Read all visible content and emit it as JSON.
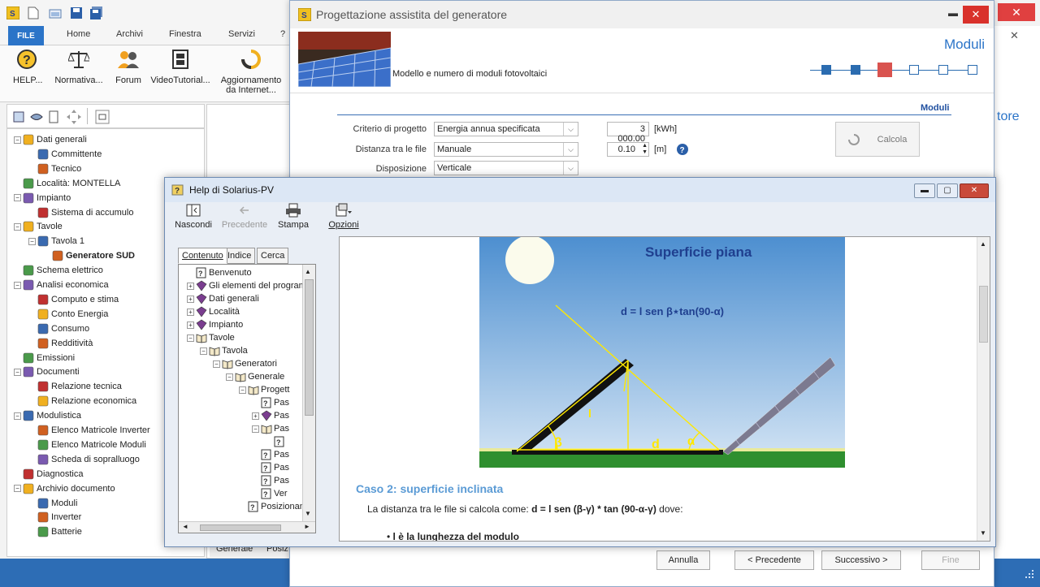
{
  "app": {
    "ribbon_tabs": [
      "FILE",
      "Home",
      "Archivi",
      "Finestra",
      "Servizi",
      "?"
    ],
    "ribbon_buttons": [
      {
        "label": "HELP...",
        "icon": "help-icon"
      },
      {
        "label": "Normativa...",
        "icon": "scales-icon"
      },
      {
        "label": "Forum",
        "icon": "users-icon"
      },
      {
        "label": "VideoTutorial...",
        "icon": "film-icon"
      },
      {
        "label": "Aggiornamento\nda Internet...",
        "icon": "refresh-icon"
      }
    ],
    "right_label": "tore",
    "close_x": "✕",
    "tree": [
      {
        "label": "Dati generali",
        "level": 0,
        "bold": false
      },
      {
        "label": "Committente",
        "level": 1
      },
      {
        "label": "Tecnico",
        "level": 1
      },
      {
        "label": "Località: MONTELLA",
        "level": 0
      },
      {
        "label": "Impianto",
        "level": 0
      },
      {
        "label": "Sistema di accumulo",
        "level": 1
      },
      {
        "label": "Tavole",
        "level": 0
      },
      {
        "label": "Tavola 1",
        "level": 1
      },
      {
        "label": "Generatore SUD",
        "level": 2,
        "bold": true
      },
      {
        "label": "Schema elettrico",
        "level": 0
      },
      {
        "label": "Analisi economica",
        "level": 0
      },
      {
        "label": "Computo e stima",
        "level": 1
      },
      {
        "label": "Conto Energia",
        "level": 1
      },
      {
        "label": "Consumo",
        "level": 1
      },
      {
        "label": "Redditività",
        "level": 1
      },
      {
        "label": "Emissioni",
        "level": 0
      },
      {
        "label": "Documenti",
        "level": 0
      },
      {
        "label": "Relazione tecnica",
        "level": 1
      },
      {
        "label": "Relazione economica",
        "level": 1
      },
      {
        "label": "Modulistica",
        "level": 0
      },
      {
        "label": "Elenco Matricole Inverter",
        "level": 1
      },
      {
        "label": "Elenco Matricole Moduli",
        "level": 1
      },
      {
        "label": "Scheda di sopralluogo",
        "level": 1
      },
      {
        "label": "Diagnostica",
        "level": 0
      },
      {
        "label": "Archivio documento",
        "level": 0
      },
      {
        "label": "Moduli",
        "level": 1
      },
      {
        "label": "Inverter",
        "level": 1
      },
      {
        "label": "Batterie",
        "level": 1
      }
    ],
    "bottom_tabs": [
      "Generale",
      "Posiz"
    ]
  },
  "wizard": {
    "title": "Progettazione assistita del generatore",
    "header_title": "Moduli",
    "header_subtitle": "Modello e numero di moduli fotovoltaici",
    "section_label": "Moduli",
    "criterio_label": "Criterio di progetto",
    "criterio_value": "Energia annua specificata",
    "energia_value": "3 000.00",
    "energia_unit": "[kWh]",
    "distanza_label": "Distanza tra le file",
    "distanza_value": "Manuale",
    "distanza_num": "0.10",
    "distanza_unit": "[m]",
    "disposizione_label": "Disposizione",
    "disposizione_value": "Verticale",
    "calcola": "Calcola",
    "annulla": "Annulla",
    "precedente": "< Precedente",
    "successivo": "Successivo >",
    "fine": "Fine",
    "steps": 6,
    "current_step": 3
  },
  "help": {
    "title": "Help di Solarius-PV",
    "toolbar": {
      "nascondi": "Nascondi",
      "precedente": "Precedente",
      "stampa": "Stampa",
      "opzioni": "Opzioni"
    },
    "tabs": {
      "contenuto": "Contenuto",
      "indice": "Indice",
      "cerca": "Cerca"
    },
    "tree": [
      {
        "label": "Benvenuto",
        "level": 0,
        "type": "page"
      },
      {
        "label": "Gli elementi del program",
        "level": 0,
        "type": "book"
      },
      {
        "label": "Dati generali",
        "level": 0,
        "type": "book"
      },
      {
        "label": "Località",
        "level": 0,
        "type": "book"
      },
      {
        "label": "Impianto",
        "level": 0,
        "type": "book"
      },
      {
        "label": "Tavole",
        "level": 0,
        "type": "open"
      },
      {
        "label": "Tavola",
        "level": 1,
        "type": "open"
      },
      {
        "label": "Generatori",
        "level": 2,
        "type": "open"
      },
      {
        "label": "Generale",
        "level": 3,
        "type": "open"
      },
      {
        "label": "Progett",
        "level": 4,
        "type": "open"
      },
      {
        "label": "Pas",
        "level": 5,
        "type": "page"
      },
      {
        "label": "Pas",
        "level": 5,
        "type": "book"
      },
      {
        "label": "Pas",
        "level": 5,
        "type": "open"
      },
      {
        "label": "",
        "level": 6,
        "type": "page"
      },
      {
        "label": "Pas",
        "level": 5,
        "type": "page"
      },
      {
        "label": "Pas",
        "level": 5,
        "type": "page"
      },
      {
        "label": "Pas",
        "level": 5,
        "type": "page"
      },
      {
        "label": "Ver",
        "level": 5,
        "type": "page"
      },
      {
        "label": "Posizionam",
        "level": 4,
        "type": "page"
      }
    ],
    "figure_title": "Superficie piana",
    "figure_formula": "d = l sen β⋆tan(90-α)",
    "figure_l": "l",
    "figure_d": "d",
    "figure_beta": "β",
    "figure_alpha": "α",
    "case_title": "Caso 2: superficie inclinata",
    "case_text_pre": "La distanza tra le file si calcola come: ",
    "case_formula": "d = l sen (β-γ) * tan (90-α-γ)",
    "case_text_post": " dove:",
    "bullet": "l è la lunghezza del modulo",
    "bullet_bold": "l"
  },
  "colors": {
    "accent": "#2b74c8",
    "step_current": "#d9534f",
    "case_title": "#5b9bd5",
    "figure_title": "#1f3f8f"
  }
}
